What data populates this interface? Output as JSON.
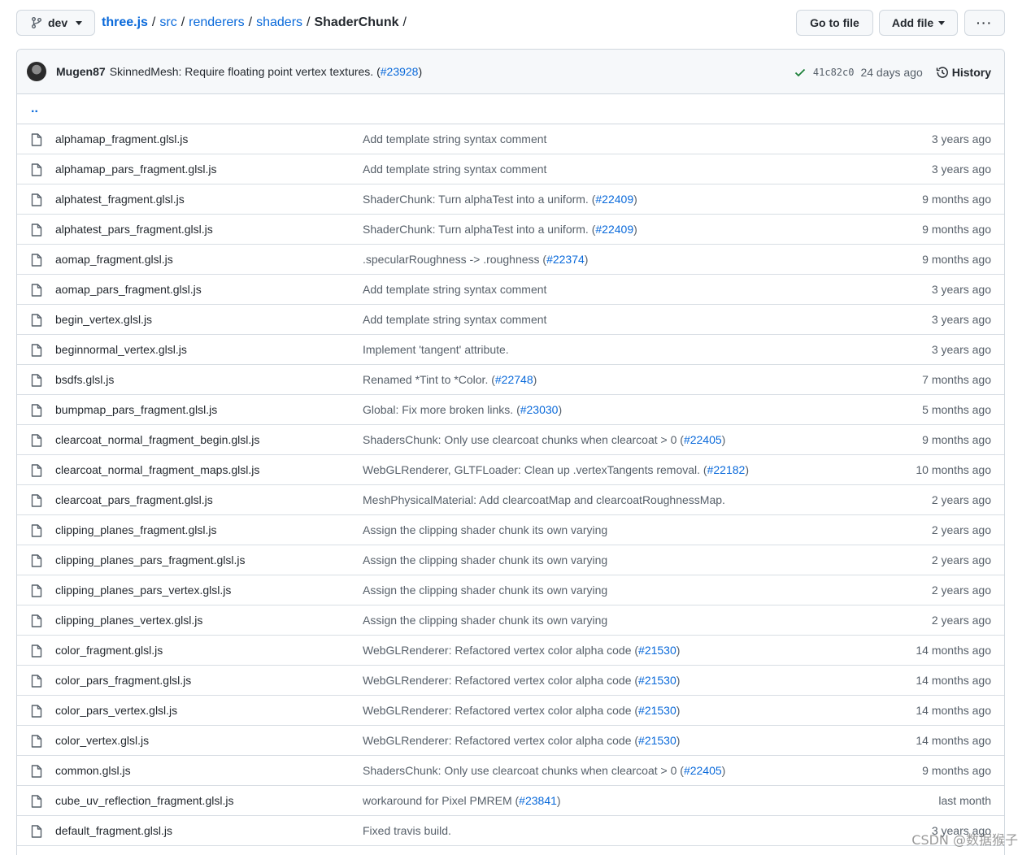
{
  "branch": {
    "name": "dev"
  },
  "breadcrumb": {
    "items": [
      "three.js",
      "src",
      "renderers",
      "shaders"
    ],
    "separator": "/",
    "current": "ShaderChunk",
    "trailing": "/"
  },
  "actions": {
    "go_to_file": "Go to file",
    "add_file": "Add file",
    "more": "···"
  },
  "commit": {
    "author": "Mugen87",
    "message": "SkinnedMesh: Require floating point vertex textures. (",
    "pr": "#23928",
    "message_end": ")",
    "sha": "41c82c0",
    "age": "24 days ago",
    "history_label": "History",
    "status_color": "#1a7f37"
  },
  "parent_dir": "..",
  "files": [
    {
      "name": "alphamap_fragment.glsl.js",
      "pre": "Add template string syntax comment",
      "link": "",
      "post": "",
      "age": "3 years ago"
    },
    {
      "name": "alphamap_pars_fragment.glsl.js",
      "pre": "Add template string syntax comment",
      "link": "",
      "post": "",
      "age": "3 years ago"
    },
    {
      "name": "alphatest_fragment.glsl.js",
      "pre": "ShaderChunk: Turn alphaTest into a uniform. (",
      "link": "#22409",
      "post": ")",
      "age": "9 months ago"
    },
    {
      "name": "alphatest_pars_fragment.glsl.js",
      "pre": "ShaderChunk: Turn alphaTest into a uniform. (",
      "link": "#22409",
      "post": ")",
      "age": "9 months ago"
    },
    {
      "name": "aomap_fragment.glsl.js",
      "pre": ".specularRoughness -> .roughness (",
      "link": "#22374",
      "post": ")",
      "age": "9 months ago"
    },
    {
      "name": "aomap_pars_fragment.glsl.js",
      "pre": "Add template string syntax comment",
      "link": "",
      "post": "",
      "age": "3 years ago"
    },
    {
      "name": "begin_vertex.glsl.js",
      "pre": "Add template string syntax comment",
      "link": "",
      "post": "",
      "age": "3 years ago"
    },
    {
      "name": "beginnormal_vertex.glsl.js",
      "pre": "Implement 'tangent' attribute.",
      "link": "",
      "post": "",
      "age": "3 years ago"
    },
    {
      "name": "bsdfs.glsl.js",
      "pre": "Renamed *Tint to *Color. (",
      "link": "#22748",
      "post": ")",
      "age": "7 months ago"
    },
    {
      "name": "bumpmap_pars_fragment.glsl.js",
      "pre": "Global: Fix more broken links. (",
      "link": "#23030",
      "post": ")",
      "age": "5 months ago"
    },
    {
      "name": "clearcoat_normal_fragment_begin.glsl.js",
      "pre": "ShadersChunk: Only use clearcoat chunks when clearcoat > 0 (",
      "link": "#22405",
      "post": ")",
      "age": "9 months ago"
    },
    {
      "name": "clearcoat_normal_fragment_maps.glsl.js",
      "pre": "WebGLRenderer, GLTFLoader: Clean up .vertexTangents removal. (",
      "link": "#22182",
      "post": ")",
      "age": "10 months ago"
    },
    {
      "name": "clearcoat_pars_fragment.glsl.js",
      "pre": "MeshPhysicalMaterial: Add clearcoatMap and clearcoatRoughnessMap.",
      "link": "",
      "post": "",
      "age": "2 years ago"
    },
    {
      "name": "clipping_planes_fragment.glsl.js",
      "pre": "Assign the clipping shader chunk its own varying",
      "link": "",
      "post": "",
      "age": "2 years ago"
    },
    {
      "name": "clipping_planes_pars_fragment.glsl.js",
      "pre": "Assign the clipping shader chunk its own varying",
      "link": "",
      "post": "",
      "age": "2 years ago"
    },
    {
      "name": "clipping_planes_pars_vertex.glsl.js",
      "pre": "Assign the clipping shader chunk its own varying",
      "link": "",
      "post": "",
      "age": "2 years ago"
    },
    {
      "name": "clipping_planes_vertex.glsl.js",
      "pre": "Assign the clipping shader chunk its own varying",
      "link": "",
      "post": "",
      "age": "2 years ago"
    },
    {
      "name": "color_fragment.glsl.js",
      "pre": "WebGLRenderer: Refactored vertex color alpha code (",
      "link": "#21530",
      "post": ")",
      "age": "14 months ago"
    },
    {
      "name": "color_pars_fragment.glsl.js",
      "pre": "WebGLRenderer: Refactored vertex color alpha code (",
      "link": "#21530",
      "post": ")",
      "age": "14 months ago"
    },
    {
      "name": "color_pars_vertex.glsl.js",
      "pre": "WebGLRenderer: Refactored vertex color alpha code (",
      "link": "#21530",
      "post": ")",
      "age": "14 months ago"
    },
    {
      "name": "color_vertex.glsl.js",
      "pre": "WebGLRenderer: Refactored vertex color alpha code (",
      "link": "#21530",
      "post": ")",
      "age": "14 months ago"
    },
    {
      "name": "common.glsl.js",
      "pre": "ShadersChunk: Only use clearcoat chunks when clearcoat > 0 (",
      "link": "#22405",
      "post": ")",
      "age": "9 months ago"
    },
    {
      "name": "cube_uv_reflection_fragment.glsl.js",
      "pre": "workaround for Pixel PMREM (",
      "link": "#23841",
      "post": ")",
      "age": "last month"
    },
    {
      "name": "default_fragment.glsl.js",
      "pre": "Fixed travis build.",
      "link": "",
      "post": "",
      "age": "3 years ago"
    }
  ],
  "watermark": "CSDN @数据猴子"
}
